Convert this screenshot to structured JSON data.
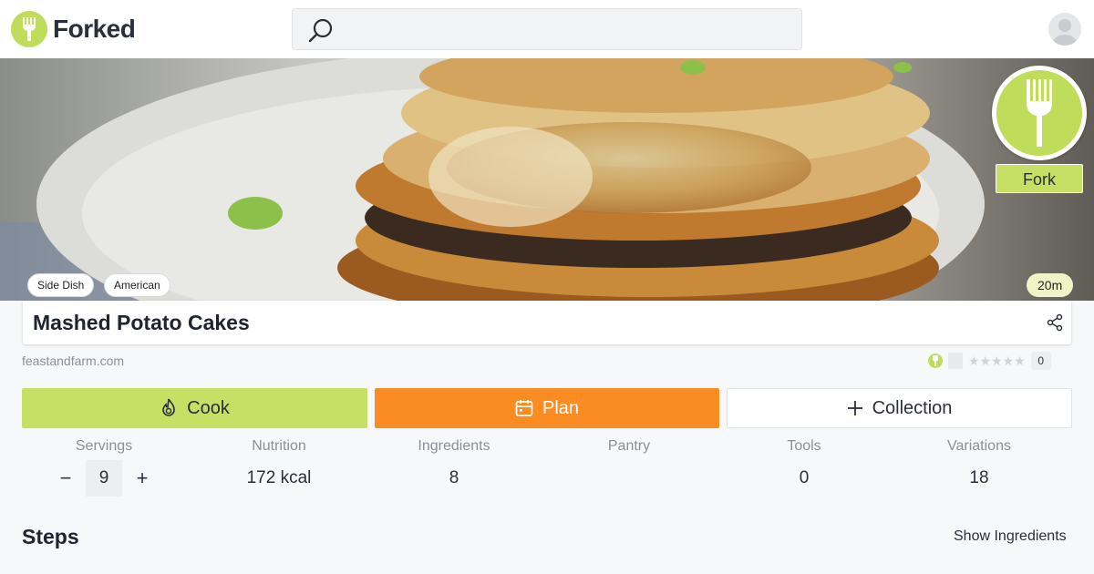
{
  "brand": {
    "name": "Forked",
    "color": "#bfdc5a"
  },
  "search": {
    "placeholder": "",
    "value": ""
  },
  "recipe": {
    "tags": [
      "Side Dish",
      "American"
    ],
    "time": "20m",
    "fork_label": "Fork",
    "title": "Mashed Potato Cakes",
    "source": "feastandfarm.com",
    "rating_count": "0",
    "stars": "★★★★★"
  },
  "actions": {
    "cook": "Cook",
    "plan": "Plan",
    "collection": "Collection",
    "cook_color": "#c6e065",
    "plan_color": "#fb8c22"
  },
  "stats": {
    "servings_label": "Servings",
    "servings_value": "9",
    "minus": "−",
    "plus": "+",
    "nutrition_label": "Nutrition",
    "nutrition_value": "172 kcal",
    "ingredients_label": "Ingredients",
    "ingredients_value": "8",
    "pantry_label": "Pantry",
    "pantry_value": "",
    "tools_label": "Tools",
    "tools_value": "0",
    "variations_label": "Variations",
    "variations_value": "18"
  },
  "section": {
    "steps": "Steps",
    "show_ingredients": "Show Ingredients"
  },
  "icons": [
    "fork-icon",
    "search-icon",
    "user-icon",
    "share-icon",
    "flame-icon",
    "calendar-icon",
    "plus-icon",
    "star-icon"
  ]
}
